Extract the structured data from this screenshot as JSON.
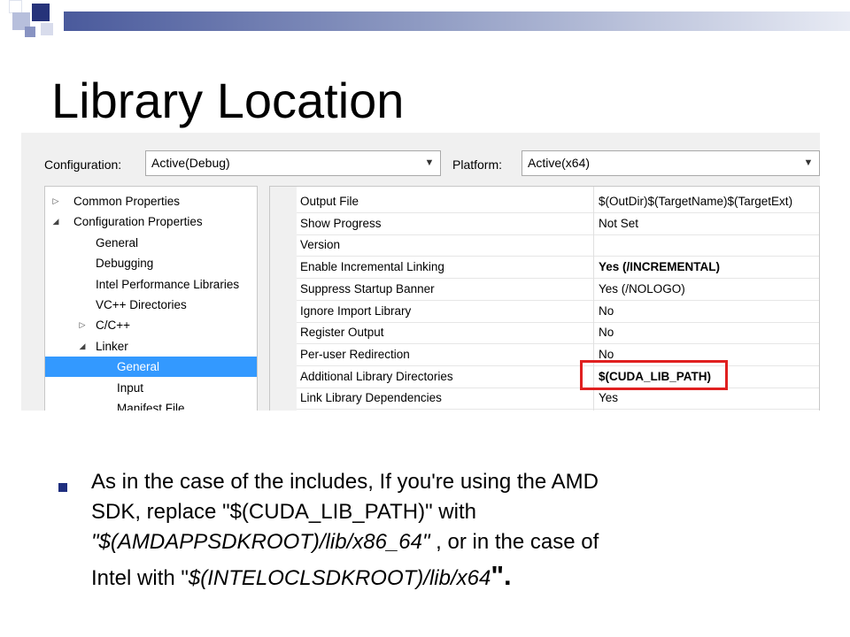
{
  "slide": {
    "title": "Library Location",
    "bullet": {
      "line1": "As in the case of the includes, If you're using the AMD",
      "line2": "SDK, replace \"$(CUDA_LIB_PATH)\" with",
      "line3_path": "\"$(AMDAPPSDKROOT)/lib/x86_64\"",
      "line3_rest": " , or in the case of",
      "line4_prefix": "Intel with \"",
      "line4_path": "$(INTELOCLSDKROOT)/lib/x64",
      "line4_suffix": "\"."
    },
    "colors": {
      "accent": "#4a5a9c",
      "bullet": "#1f2f7f",
      "highlight_box": "#e02020"
    }
  },
  "dialog": {
    "configuration_label": "Configuration:",
    "configuration_value": "Active(Debug)",
    "platform_label": "Platform:",
    "platform_value": "Active(x64)",
    "tree": [
      {
        "label": "Common Properties",
        "expander": "▷"
      },
      {
        "label": "Configuration Properties",
        "expander": "◢"
      },
      {
        "label": "General"
      },
      {
        "label": "Debugging"
      },
      {
        "label": "Intel Performance Libraries"
      },
      {
        "label": "VC++ Directories"
      },
      {
        "label": "C/C++",
        "expander": "▷"
      },
      {
        "label": "Linker",
        "expander": "◢"
      },
      {
        "label": "General",
        "selected": true
      },
      {
        "label": "Input"
      },
      {
        "label": "Manifest File"
      }
    ],
    "properties": [
      {
        "name": "Output File",
        "value": "$(OutDir)$(TargetName)$(TargetExt)"
      },
      {
        "name": "Show Progress",
        "value": "Not Set"
      },
      {
        "name": "Version",
        "value": ""
      },
      {
        "name": "Enable Incremental Linking",
        "value": "Yes (/INCREMENTAL)",
        "bold": true
      },
      {
        "name": "Suppress Startup Banner",
        "value": "Yes (/NOLOGO)"
      },
      {
        "name": "Ignore Import Library",
        "value": "No"
      },
      {
        "name": "Register Output",
        "value": "No"
      },
      {
        "name": "Per-user Redirection",
        "value": "No"
      },
      {
        "name": "Additional Library Directories",
        "value": "$(CUDA_LIB_PATH)",
        "bold": true
      },
      {
        "name": "Link Library Dependencies",
        "value": "Yes"
      }
    ]
  }
}
